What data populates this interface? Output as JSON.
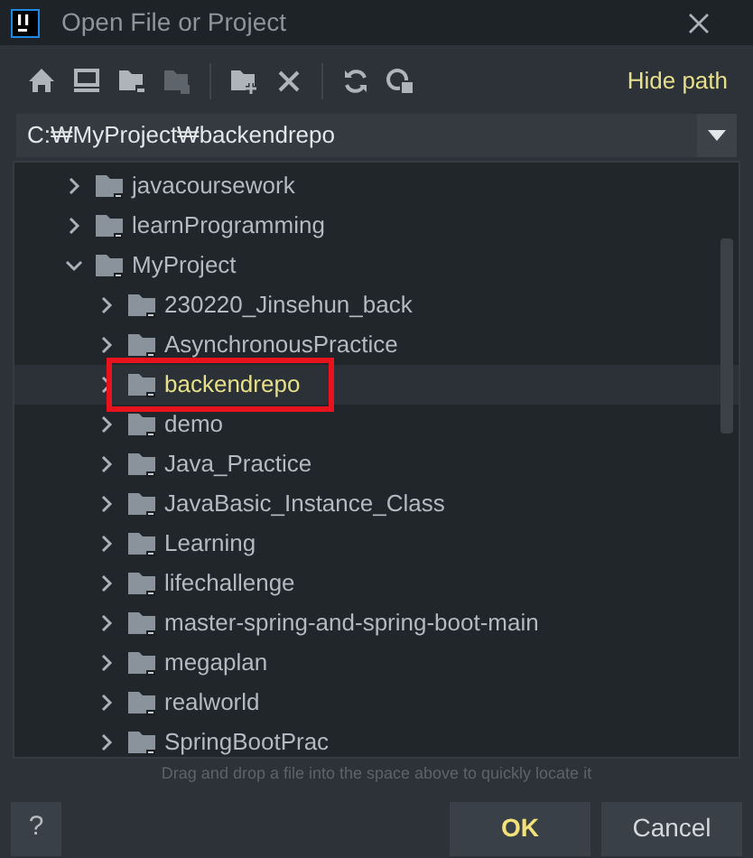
{
  "window": {
    "title": "Open File or Project"
  },
  "toolbar": {
    "hide_path": "Hide path"
  },
  "path_field": {
    "value": "C:₩MyProject₩backendrepo"
  },
  "tree": [
    {
      "name": "javacoursework",
      "expanded": false,
      "selected": false
    },
    {
      "name": "learnProgramming",
      "expanded": false,
      "selected": false
    },
    {
      "name": "MyProject",
      "expanded": true,
      "selected": false,
      "children": [
        {
          "name": "230220_Jinsehun_back",
          "expanded": false,
          "selected": false
        },
        {
          "name": "AsynchronousPractice",
          "expanded": false,
          "selected": false
        },
        {
          "name": "backendrepo",
          "expanded": false,
          "selected": true,
          "highlighted": true
        },
        {
          "name": "demo",
          "expanded": false,
          "selected": false
        },
        {
          "name": "Java_Practice",
          "expanded": false,
          "selected": false
        },
        {
          "name": "JavaBasic_Instance_Class",
          "expanded": false,
          "selected": false
        },
        {
          "name": "Learning",
          "expanded": false,
          "selected": false
        },
        {
          "name": "lifechallenge",
          "expanded": false,
          "selected": false
        },
        {
          "name": "master-spring-and-spring-boot-main",
          "expanded": false,
          "selected": false
        },
        {
          "name": "megaplan",
          "expanded": false,
          "selected": false
        },
        {
          "name": "realworld",
          "expanded": false,
          "selected": false
        },
        {
          "name": "SpringBootPrac",
          "expanded": false,
          "selected": false
        }
      ]
    }
  ],
  "hint": "Drag and drop a file into the space above to quickly locate it",
  "buttons": {
    "help": "?",
    "ok": "OK",
    "cancel": "Cancel"
  }
}
